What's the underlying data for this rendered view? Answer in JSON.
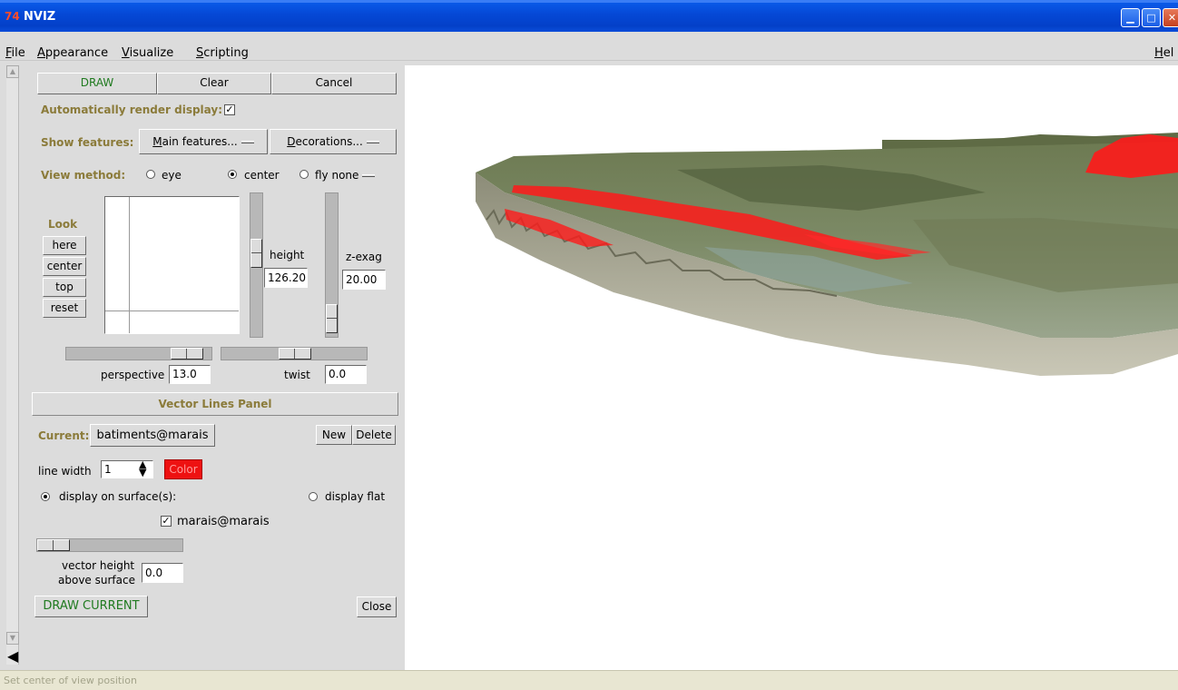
{
  "window": {
    "title": "NVIZ",
    "icon_text": "74"
  },
  "menubar": {
    "items": [
      {
        "label": "File",
        "ul": "F",
        "rest": "ile"
      },
      {
        "label": "Appearance",
        "ul": "A",
        "rest": "ppearance"
      },
      {
        "label": "Visualize",
        "ul": "V",
        "rest": "isualize"
      },
      {
        "label": "Scripting",
        "ul": "S",
        "rest": "cripting"
      }
    ],
    "help": {
      "ul": "H",
      "rest": "el"
    }
  },
  "draw_bar": {
    "draw": "DRAW",
    "clear": "Clear",
    "cancel": "Cancel"
  },
  "auto_render": {
    "label": "Automatically render display:",
    "checked": true
  },
  "features": {
    "label": "Show features:",
    "main_ul": "M",
    "main_rest": "ain features...",
    "deco_ul": "D",
    "deco_rest": "ecorations..."
  },
  "view_method": {
    "label": "View method:",
    "options": [
      "eye",
      "center",
      "fly none"
    ],
    "selected": "center"
  },
  "look": {
    "title": "Look",
    "buttons": [
      "here",
      "center",
      "top",
      "reset"
    ]
  },
  "height": {
    "label": "height",
    "value": "126.20"
  },
  "zexag": {
    "label": "z-exag",
    "value": "20.00"
  },
  "perspective": {
    "label": "perspective",
    "value": "13.0"
  },
  "twist": {
    "label": "twist",
    "value": "0.0"
  },
  "vector_panel": {
    "title": "Vector Lines Panel",
    "current_label": "Current:",
    "current_value": "batiments@marais",
    "new": "New",
    "delete": "Delete",
    "line_width_label": "line width",
    "line_width_value": "1",
    "color_label": "Color",
    "color_hex": "#ee1111",
    "surface_option": "display on surface(s):",
    "flat_option": "display flat",
    "surface_name": "marais@marais",
    "surface_checked": true,
    "vheight_label_1": "vector height",
    "vheight_label_2": "above surface",
    "vheight_value": "0.0",
    "draw_current": "DRAW CURRENT",
    "close": "Close"
  },
  "status": {
    "text": "Set center of view position"
  },
  "colors": {
    "titlebar": "#0548d6",
    "label_olive": "#8b7b3a",
    "draw_green": "#1f7a1f",
    "vector_red": "#ee1111"
  }
}
